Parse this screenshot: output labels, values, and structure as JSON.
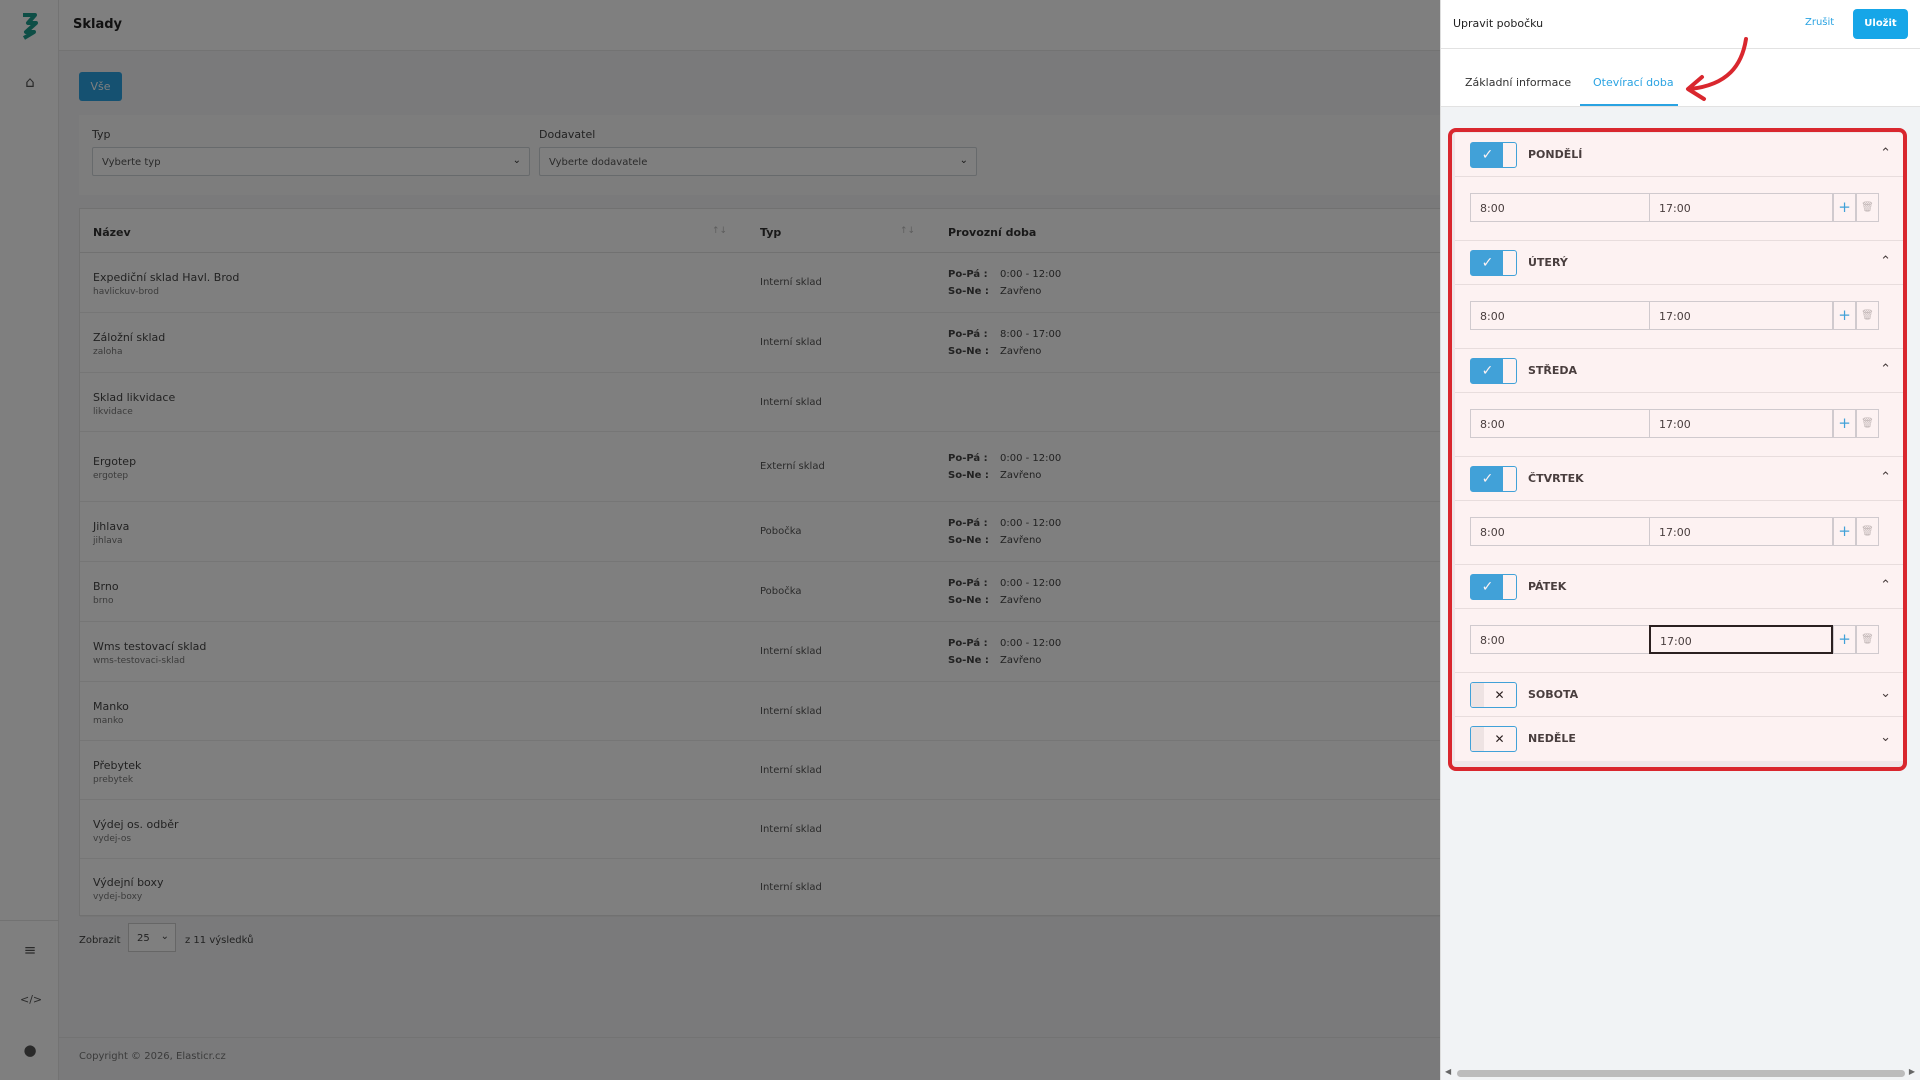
{
  "page": {
    "title": "Sklady"
  },
  "filter_button": "Vše",
  "filters": {
    "type_label": "Typ",
    "type_placeholder": "Vyberte typ",
    "supplier_label": "Dodavatel",
    "supplier_placeholder": "Vyberte dodavatele"
  },
  "table": {
    "headers": {
      "name": "Název",
      "type": "Typ",
      "hours": "Provozní doba"
    },
    "sort_glyph": "↑↓",
    "rows": [
      {
        "name": "Expediční sklad Havl. Brod",
        "slug": "havlickuv-brod",
        "type": "Interní sklad",
        "hours": [
          {
            "d": "Po-Pá :",
            "t": "0:00 - 12:00"
          },
          {
            "d": "So-Ne :",
            "t": "Zavřeno"
          }
        ]
      },
      {
        "name": "Záložní sklad",
        "slug": "zaloha",
        "type": "Interní sklad",
        "hours": [
          {
            "d": "Po-Pá :",
            "t": "8:00 - 17:00"
          },
          {
            "d": "So-Ne :",
            "t": "Zavřeno"
          }
        ]
      },
      {
        "name": "Sklad likvidace",
        "slug": "likvidace",
        "type": "Interní sklad",
        "hours": []
      },
      {
        "name": "Ergotep",
        "slug": "ergotep",
        "type": "Externí sklad",
        "hours": [
          {
            "d": "Po-Pá :",
            "t": "0:00 - 12:00"
          },
          {
            "d": "So-Ne :",
            "t": "Zavřeno"
          }
        ]
      },
      {
        "name": "Jihlava",
        "slug": "jihlava",
        "type": "Pobočka",
        "hours": [
          {
            "d": "Po-Pá :",
            "t": "0:00 - 12:00"
          },
          {
            "d": "So-Ne :",
            "t": "Zavřeno"
          }
        ]
      },
      {
        "name": "Brno",
        "slug": "brno",
        "type": "Pobočka",
        "hours": [
          {
            "d": "Po-Pá :",
            "t": "0:00 - 12:00"
          },
          {
            "d": "So-Ne :",
            "t": "Zavřeno"
          }
        ]
      },
      {
        "name": "Wms testovací sklad",
        "slug": "wms-testovaci-sklad",
        "type": "Interní sklad",
        "hours": [
          {
            "d": "Po-Pá :",
            "t": "0:00 - 12:00"
          },
          {
            "d": "So-Ne :",
            "t": "Zavřeno"
          }
        ]
      },
      {
        "name": "Manko",
        "slug": "manko",
        "type": "Interní sklad",
        "hours": []
      },
      {
        "name": "Přebytek",
        "slug": "prebytek",
        "type": "Interní sklad",
        "hours": []
      },
      {
        "name": "Výdej os. odběr",
        "slug": "vydej-os",
        "type": "Interní sklad",
        "hours": []
      },
      {
        "name": "Výdejní boxy",
        "slug": "vydej-boxy",
        "type": "Interní sklad",
        "hours": []
      }
    ]
  },
  "pager": {
    "show_label": "Zobrazit",
    "page_size": "25",
    "total": "z 11 výsledků"
  },
  "footer": {
    "copyright": "Copyright © 2026, Elasticr.cz"
  },
  "panel": {
    "title": "Upravit pobočku",
    "cancel": "Zrušit",
    "save": "Uložit",
    "tabs": [
      "Základní informace",
      "Otevírací doba"
    ],
    "active_tab": 1,
    "days": [
      {
        "label": "PONDĚLÍ",
        "enabled": true,
        "from": "8:00",
        "to": "17:00"
      },
      {
        "label": "ÚTERÝ",
        "enabled": true,
        "from": "8:00",
        "to": "17:00"
      },
      {
        "label": "STŘEDA",
        "enabled": true,
        "from": "8:00",
        "to": "17:00"
      },
      {
        "label": "ČTVRTEK",
        "enabled": true,
        "from": "8:00",
        "to": "17:00"
      },
      {
        "label": "PÁTEK",
        "enabled": true,
        "from": "8:00",
        "to": "17:00"
      },
      {
        "label": "SOBOTA",
        "enabled": false
      },
      {
        "label": "NEDĚLE",
        "enabled": false
      }
    ]
  },
  "icons": {
    "check": "✓",
    "cross": "✕",
    "chevron_up": "⌃",
    "chevron_down": "⌄",
    "plus": "+",
    "trash": "🗑"
  },
  "colors": {
    "accent": "#2aa3e2",
    "highlight": "#d9272e"
  }
}
